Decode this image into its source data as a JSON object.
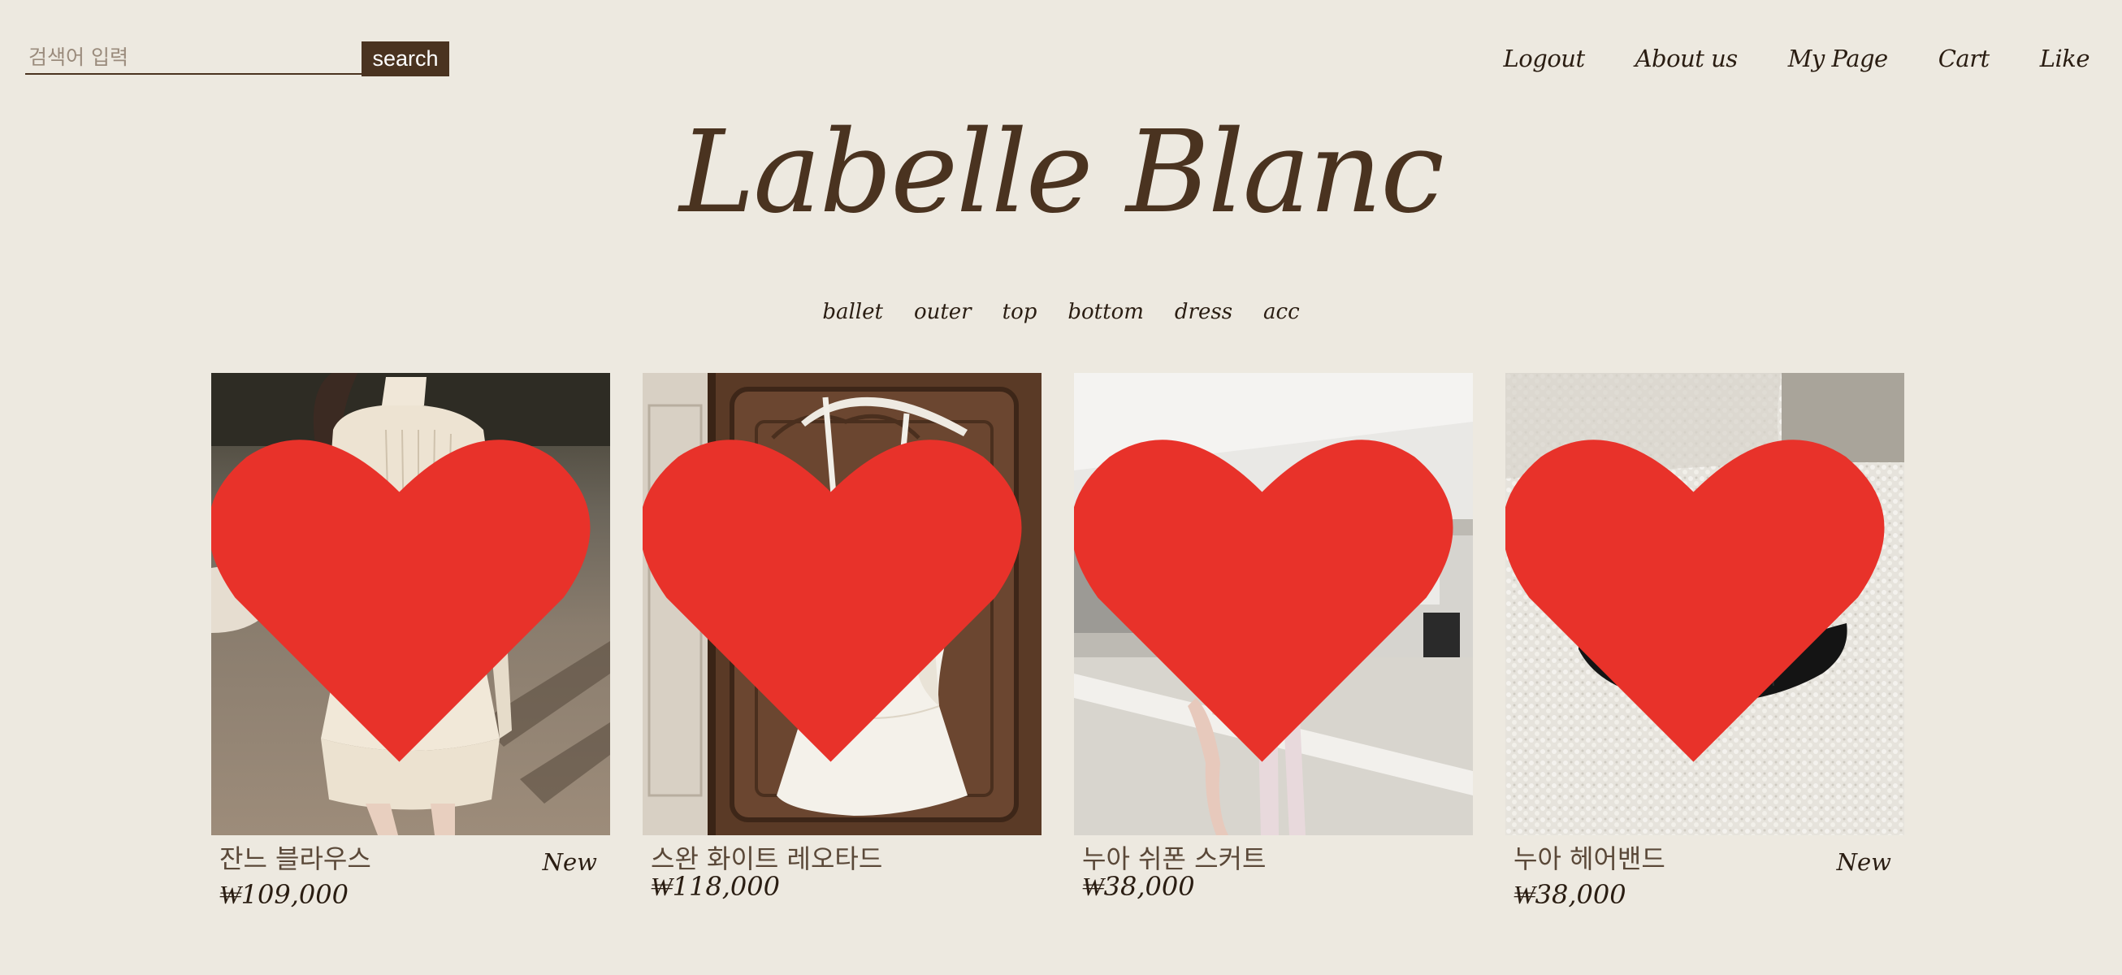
{
  "search": {
    "placeholder": "검색어 입력",
    "button_label": "search"
  },
  "top_nav": {
    "items": [
      {
        "label": "Logout"
      },
      {
        "label": "About us"
      },
      {
        "label": "My Page"
      },
      {
        "label": "Cart"
      },
      {
        "label": "Like"
      }
    ]
  },
  "brand": {
    "logo_text": "Labelle Blanc",
    "color": "#4a3320"
  },
  "categories": [
    {
      "label": "ballet"
    },
    {
      "label": "outer"
    },
    {
      "label": "top"
    },
    {
      "label": "bottom"
    },
    {
      "label": "dress"
    },
    {
      "label": "acc"
    }
  ],
  "products": [
    {
      "name": "잔느 블라우스",
      "price": "₩109,000",
      "badge": "New",
      "image": "cream pleated blouse with ruffled skirt",
      "liked": true
    },
    {
      "name": "스완 화이트 레오타드",
      "price": "₩118,000",
      "badge": "",
      "image": "white lace leotard on hanger against wooden door",
      "liked": true
    },
    {
      "name": "누아 쉬폰 스커트",
      "price": "₩38,000",
      "badge": "",
      "image": "dancer in black leotard at ballet barre",
      "liked": true
    },
    {
      "name": "누아 헤어밴드",
      "price": "₩38,000",
      "badge": "New",
      "image": "black knotted headband on white boucle fabric",
      "liked": true
    }
  ],
  "colors": {
    "background": "#ede9e0",
    "accent": "#4a3320",
    "heart": "#e8322a"
  }
}
